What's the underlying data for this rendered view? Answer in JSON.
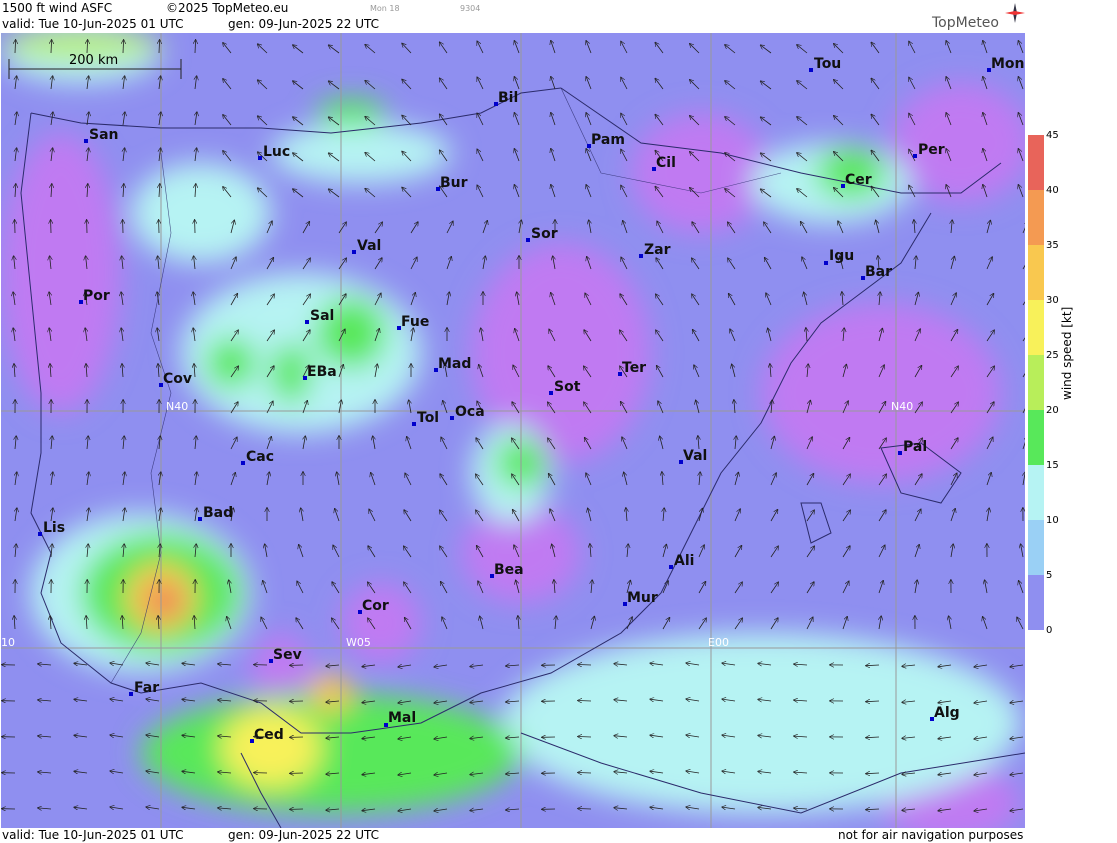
{
  "header": {
    "product": "1500 ft wind ASFC",
    "copyright": "©2025 TopMeteo.eu",
    "tiny1": "Mon 18",
    "tiny2": "9304",
    "valid": "valid:  Tue  10-Jun-2025  01 UTC",
    "gen": "gen:  09-Jun-2025 22 UTC",
    "logo": "TopMeteo"
  },
  "footer": {
    "valid": "valid:  Tue  10-Jun-2025  01 UTC",
    "gen": "gen:  09-Jun-2025 22 UTC",
    "disclaimer": "not for air navigation purposes"
  },
  "scale_bar": "200 km",
  "grid_labels": [
    "N40",
    "N40",
    "W05",
    "E00",
    "10"
  ],
  "colorbar": {
    "title": "wind speed  [kt]",
    "ticks": [
      "45",
      "40",
      "35",
      "30",
      "25",
      "20",
      "15",
      "10",
      "5",
      "0"
    ],
    "colors": [
      "#e8645a",
      "#f49a52",
      "#f9c84f",
      "#f8f15a",
      "#b8ee5a",
      "#58e85a",
      "#b6f3f3",
      "#9ad0f5",
      "#8f8ff0",
      "#c07af2"
    ]
  },
  "cities": [
    {
      "name": "San"
    },
    {
      "name": "Luc"
    },
    {
      "name": "Bil"
    },
    {
      "name": "Pam"
    },
    {
      "name": "Tou"
    },
    {
      "name": "Mon"
    },
    {
      "name": "Cil"
    },
    {
      "name": "Per"
    },
    {
      "name": "Bur"
    },
    {
      "name": "Cer"
    },
    {
      "name": "Sor"
    },
    {
      "name": "Val"
    },
    {
      "name": "Zar"
    },
    {
      "name": "Igu"
    },
    {
      "name": "Bar"
    },
    {
      "name": "Por"
    },
    {
      "name": "Sal"
    },
    {
      "name": "Fue"
    },
    {
      "name": "Mad"
    },
    {
      "name": "Cov"
    },
    {
      "name": "EBa"
    },
    {
      "name": "Sot"
    },
    {
      "name": "Ter"
    },
    {
      "name": "Tol"
    },
    {
      "name": "Oca"
    },
    {
      "name": "Cac"
    },
    {
      "name": "Pal"
    },
    {
      "name": "Val"
    },
    {
      "name": "Bad"
    },
    {
      "name": "Lis"
    },
    {
      "name": "Ali"
    },
    {
      "name": "Bea"
    },
    {
      "name": "Mur"
    },
    {
      "name": "Cor"
    },
    {
      "name": "Sev"
    },
    {
      "name": "Far"
    },
    {
      "name": "Mal"
    },
    {
      "name": "Ced"
    },
    {
      "name": "Alg"
    }
  ]
}
